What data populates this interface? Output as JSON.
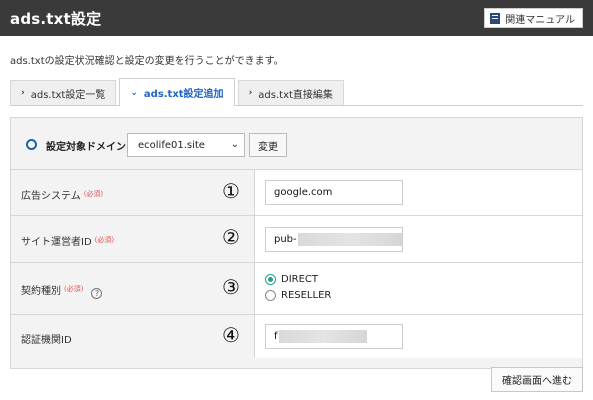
{
  "header": {
    "title": "ads.txt設定",
    "manual_button": "関連マニュアル",
    "manual_icon": "book-icon"
  },
  "description": "ads.txtの設定状況確認と設定の変更を行うことができます。",
  "tabs": [
    {
      "label": "ads.txt設定一覧",
      "icon": "chevron-right-icon",
      "active": false
    },
    {
      "label": "ads.txt設定追加",
      "icon": "chevron-down-icon",
      "active": true
    },
    {
      "label": "ads.txt直接編集",
      "icon": "chevron-right-icon",
      "active": false
    }
  ],
  "domain": {
    "label": "設定対象ドメイン",
    "selected": "ecolife01.site",
    "change_button": "変更"
  },
  "form": {
    "required_mark": "(必須)",
    "ad_system": {
      "label": "広告システム",
      "marker": "①",
      "value": "google.com"
    },
    "publisher_id": {
      "label": "サイト運営者ID",
      "marker": "②",
      "value": "pub-"
    },
    "contract_type": {
      "label": "契約種別",
      "marker": "③",
      "help": "?",
      "options": [
        {
          "label": "DIRECT",
          "checked": true
        },
        {
          "label": "RESELLER",
          "checked": false
        }
      ]
    },
    "cert_id": {
      "label": "認証機関ID",
      "marker": "④",
      "value": "f"
    }
  },
  "confirm_button": "確認画面へ進む",
  "colors": {
    "header_bg": "#3a3a3a",
    "active_tab_text": "#1e66c4",
    "required": "#e05252",
    "radio_checked": "#2a9d8f"
  }
}
